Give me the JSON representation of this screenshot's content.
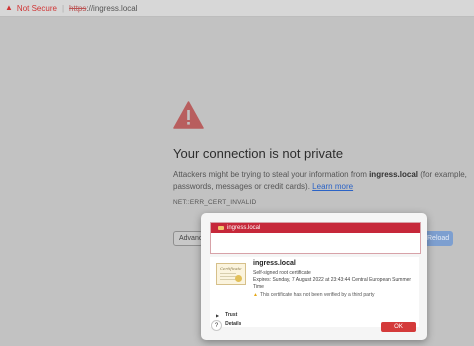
{
  "address_bar": {
    "security_icon": "warning-triangle-icon",
    "security_label": "Not Secure",
    "separator": "|",
    "url_scheme": "https",
    "url_rest": "://ingress.local"
  },
  "interstitial": {
    "icon": "danger-triangle-icon",
    "headline": "Your connection is not private",
    "message_before": "Attackers might be trying to steal your information from ",
    "host": "ingress.local",
    "message_after": " (for example, passwords, messages or credit cards). ",
    "learn_more": "Learn more",
    "error_code": "NET::ERR_CERT_INVALID",
    "advanced_label": "Advanced",
    "reload_label": "Reload"
  },
  "cert_dialog": {
    "chain": [
      "ingress.local"
    ],
    "name": "ingress.local",
    "type": "Self-signed root certificate",
    "expires": "Expires: Sunday, 7 August 2022 at 23:43:44 Central European Summer Time",
    "warning": "This certificate has not been verified by a third party",
    "trust_label": "Trust",
    "details_label": "Details",
    "help_label": "?",
    "ok_label": "OK",
    "cert_image_text": "Certificate"
  },
  "colors": {
    "error_red": "#d03434",
    "selection_red": "#c6283a",
    "link_blue": "#2b63c6",
    "reload_blue": "#7d9fd0"
  }
}
